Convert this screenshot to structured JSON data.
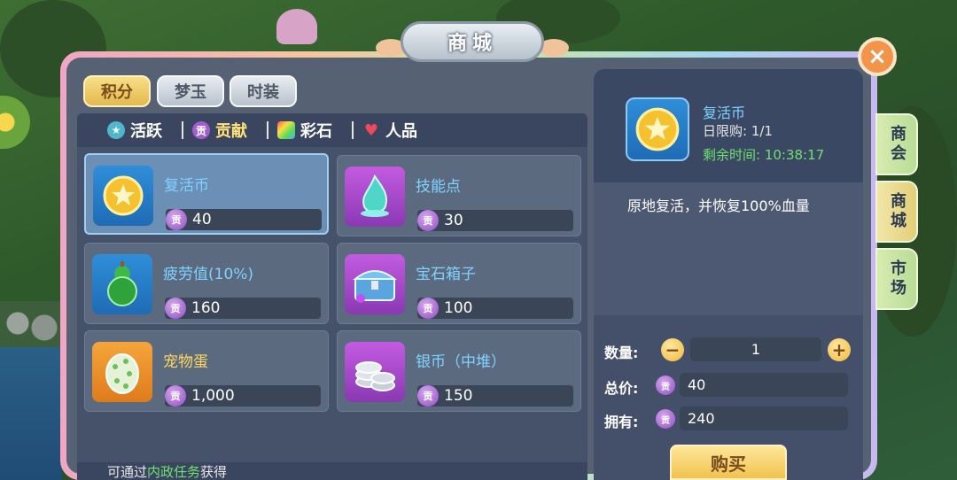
{
  "title": "商城",
  "currency_tabs": [
    {
      "label": "积分",
      "active": true
    },
    {
      "label": "梦玉",
      "active": false
    },
    {
      "label": "时装",
      "active": false
    }
  ],
  "categories": [
    {
      "label": "活跃",
      "icon": "star-badge-icon",
      "active": false
    },
    {
      "label": "贡献",
      "icon": "gong-coin-icon",
      "active": true
    },
    {
      "label": "彩石",
      "icon": "rainbow-gem-icon",
      "active": false
    },
    {
      "label": "人品",
      "icon": "heart-icon",
      "active": false
    }
  ],
  "price_badge": "贡",
  "items": [
    {
      "name": "复活币",
      "price": "40",
      "icon": "gold-star-coin-icon",
      "selected": true
    },
    {
      "name": "技能点",
      "price": "30",
      "icon": "spirit-flame-icon",
      "selected": false
    },
    {
      "name": "疲劳值(10%)",
      "price": "160",
      "icon": "green-gourd-icon",
      "selected": false
    },
    {
      "name": "宝石箱子",
      "price": "100",
      "icon": "treasure-chest-icon",
      "selected": false
    },
    {
      "name": "宠物蛋",
      "price": "1,000",
      "icon": "spotted-egg-icon",
      "selected": false
    },
    {
      "name": "银币（中堆）",
      "price": "150",
      "icon": "silver-coins-icon",
      "selected": false
    }
  ],
  "bottom_note": {
    "prefix": "可通过",
    "highlight": "内政任务",
    "suffix": "获得"
  },
  "detail": {
    "name": "复活币",
    "daily_limit": "日限购: 1/1",
    "remaining": "剩余时间: 10:38:17",
    "description": "原地复活，并恢复100%血量",
    "quantity_label": "数量:",
    "quantity": "1",
    "total_label": "总价:",
    "total": "40",
    "owned_label": "拥有:",
    "owned": "240",
    "buy_label": "购买"
  },
  "side_tabs": [
    {
      "label": "商会",
      "active": false
    },
    {
      "label": "商城",
      "active": true
    },
    {
      "label": "市场",
      "active": false
    }
  ],
  "close_label": "×",
  "colors": {
    "accent_gold": "#f1c24f",
    "name_blue": "#7fd3ff",
    "timer_green": "#6ee26e"
  }
}
